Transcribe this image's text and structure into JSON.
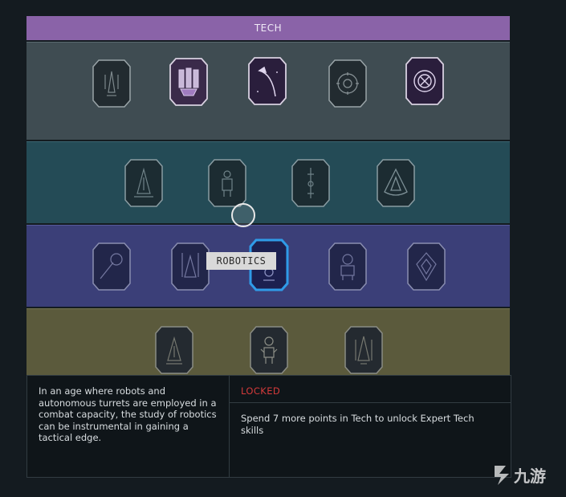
{
  "tree": {
    "title": "TECH",
    "tiers": [
      {
        "name": "tier-1",
        "skills": [
          "skill-1-1",
          "skill-1-2",
          "skill-1-3",
          "skill-1-4",
          "skill-1-5"
        ]
      },
      {
        "name": "tier-2",
        "skills": [
          "skill-2-1",
          "skill-2-2",
          "skill-2-3",
          "skill-2-4"
        ]
      },
      {
        "name": "tier-3",
        "skills": [
          "skill-3-1",
          "skill-3-2",
          "robotics",
          "skill-3-4",
          "skill-3-5"
        ]
      },
      {
        "name": "tier-4",
        "skills": [
          "skill-4-1",
          "skill-4-2",
          "skill-4-3"
        ]
      }
    ]
  },
  "tooltip": {
    "label": "ROBOTICS"
  },
  "info": {
    "description": "In an age where robots and autonomous turrets are employed in a combat capacity, the study of robotics can be instrumental in gaining a tactical edge.",
    "status": "LOCKED",
    "unlock_message": "Spend 7 more points in Tech to unlock Expert Tech skills"
  },
  "colors": {
    "header": "#8a63a8",
    "tier1": "#3f4c52",
    "tier2": "#244b56",
    "tier3": "#3b3f78",
    "tier4": "#5b5a3c",
    "selected_border": "#2f9be8",
    "locked": "#d43a3a"
  },
  "watermark": {
    "text": "九游"
  }
}
